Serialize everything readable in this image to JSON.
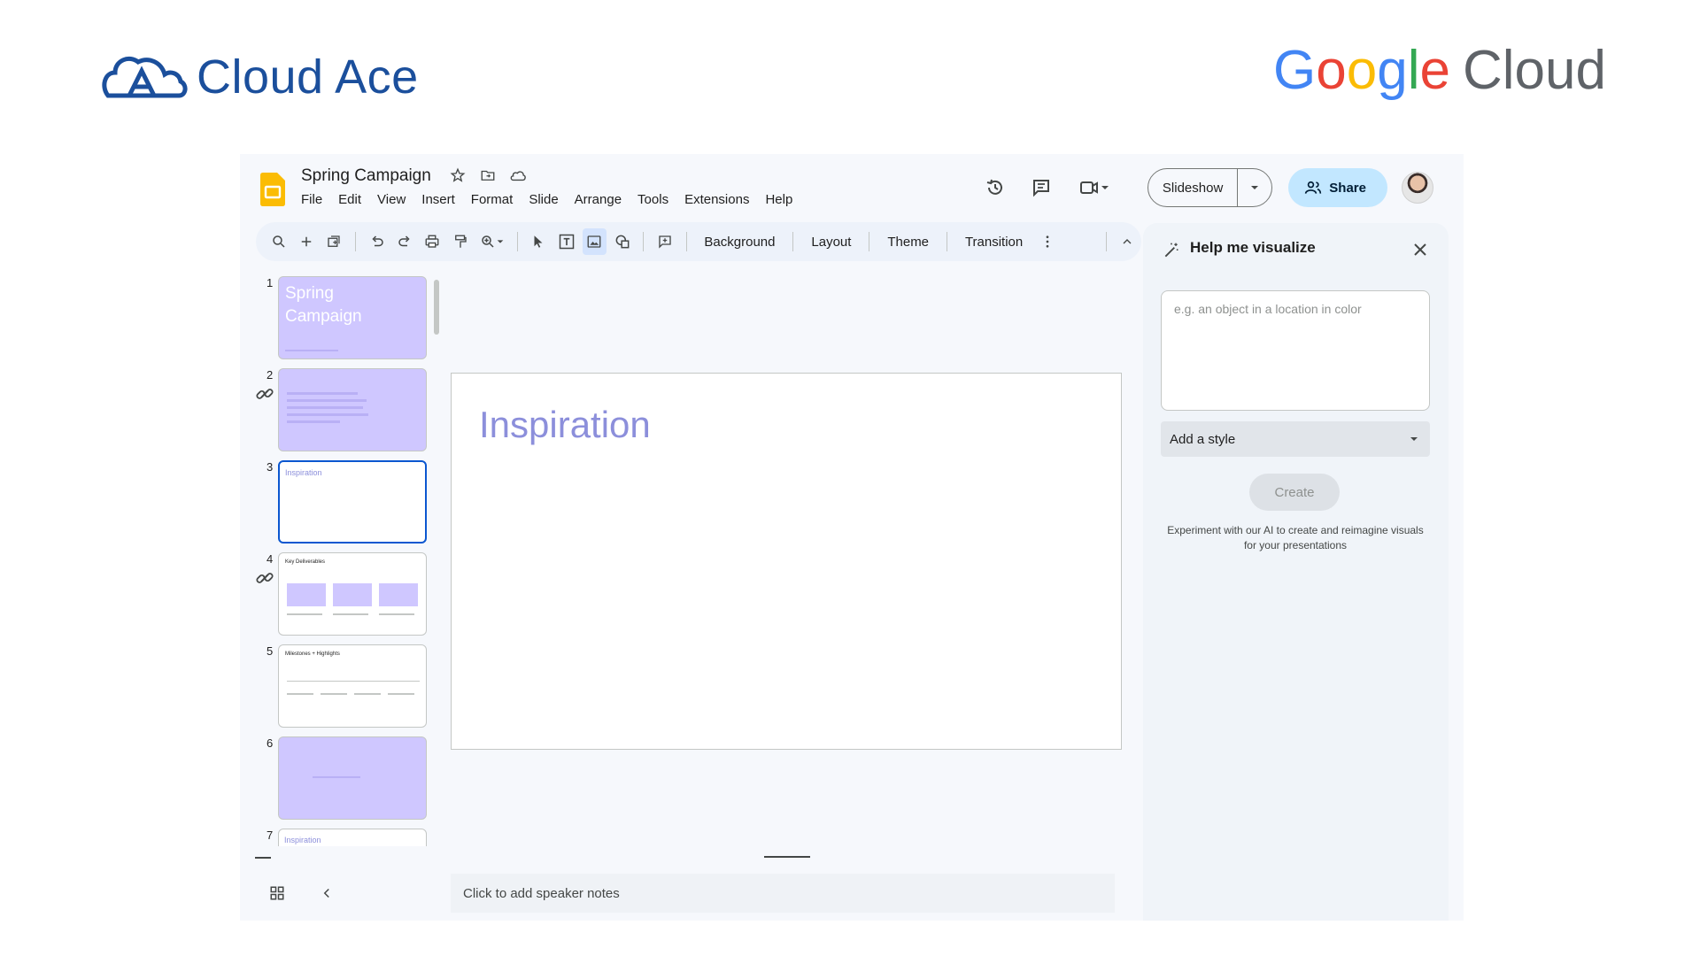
{
  "branding": {
    "left_name": "Cloud Ace",
    "right_google_letters": [
      "G",
      "o",
      "o",
      "g",
      "l",
      "e"
    ],
    "right_cloud": "Cloud"
  },
  "document": {
    "title": "Spring Campaign"
  },
  "menu": [
    "File",
    "Edit",
    "View",
    "Insert",
    "Format",
    "Slide",
    "Arrange",
    "Tools",
    "Extensions",
    "Help"
  ],
  "header": {
    "slideshow_label": "Slideshow",
    "share_label": "Share"
  },
  "toolbar": {
    "background": "Background",
    "layout": "Layout",
    "theme": "Theme",
    "transition": "Transition"
  },
  "slides": [
    {
      "number": "1",
      "title": "Spring Campaign",
      "style": "purple"
    },
    {
      "number": "2",
      "title": "",
      "style": "purple",
      "linked": true
    },
    {
      "number": "3",
      "title": "Inspiration",
      "style": "white",
      "selected": true
    },
    {
      "number": "4",
      "title": "Key Deliverables",
      "style": "white",
      "linked": true
    },
    {
      "number": "5",
      "title": "Milestones + Highlights",
      "style": "white"
    },
    {
      "number": "6",
      "title": "",
      "style": "purple"
    },
    {
      "number": "7",
      "title": "Inspiration",
      "style": "white"
    }
  ],
  "canvas": {
    "slide_title": "Inspiration",
    "notes_placeholder": "Click to add speaker notes"
  },
  "panel": {
    "title": "Help me visualize",
    "prompt_placeholder": "e.g. an object in a location in color",
    "style_label": "Add a style",
    "create_label": "Create",
    "help_text": "Experiment with our AI to create and reimagine visuals for your presentations"
  },
  "colors": {
    "accent_blue": "#0b57d0",
    "share_bg": "#c2e7ff",
    "slide_purple": "#cfc7ff",
    "title_purple": "#8c8fdb"
  },
  "icons": [
    "slides-logo-icon",
    "star-icon",
    "move-folder-icon",
    "cloud-saved-icon",
    "history-icon",
    "comment-icon",
    "meet-camera-icon",
    "people-icon",
    "search-icon",
    "add-icon",
    "new-slide-icon",
    "undo-icon",
    "redo-icon",
    "print-icon",
    "paint-format-icon",
    "zoom-icon",
    "cursor-icon",
    "text-box-icon",
    "image-icon",
    "shape-icon",
    "comment-add-icon",
    "more-vert-icon",
    "chevron-up-icon",
    "link-icon",
    "grid-view-icon",
    "chevron-left-icon",
    "wand-icon",
    "close-icon",
    "caret-down-icon"
  ]
}
